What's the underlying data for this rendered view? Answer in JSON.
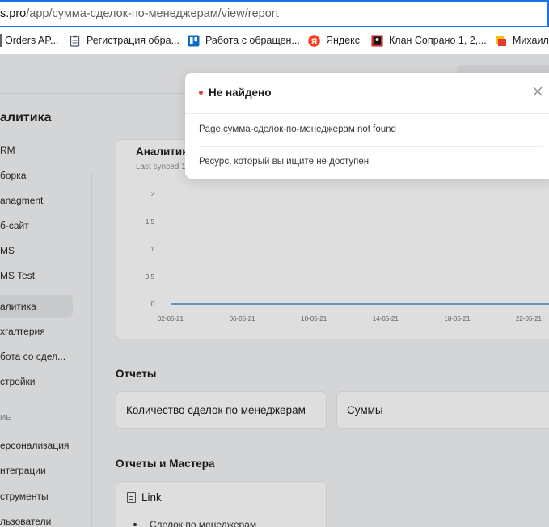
{
  "browser": {
    "url_host": "s.pro",
    "url_path": "/app/сумма-сделок-по-менеджерам/view/report",
    "bookmarks": [
      {
        "label": "Orders AP...",
        "icon": "separator-icon"
      },
      {
        "label": "Регистрация обра...",
        "icon": "clipboard-icon"
      },
      {
        "label": "Работа с обращен...",
        "icon": "trello-icon"
      },
      {
        "label": "Яндекс",
        "icon": "yandex-icon"
      },
      {
        "label": "Клан Сопрано 1, 2,...",
        "icon": "soprano-icon"
      },
      {
        "label": "Михаил",
        "icon": "folder-icon"
      }
    ]
  },
  "sidebar": {
    "title": "алитика",
    "items": [
      {
        "label": "RM"
      },
      {
        "label": "борка"
      },
      {
        "label": "anagment"
      },
      {
        "label": "б-сайт"
      },
      {
        "label": "MS"
      },
      {
        "label": "MS Test"
      },
      {
        "label": "алитика"
      },
      {
        "label": "хгалтерия"
      },
      {
        "label": "бота со сдел..."
      },
      {
        "label": "стройки"
      }
    ],
    "section_label": "ИЕ",
    "items2": [
      {
        "label": "ерсонализация"
      },
      {
        "label": "нтеграции"
      },
      {
        "label": "струменты"
      },
      {
        "label": "льзователи"
      }
    ]
  },
  "chart_card": {
    "title": "Аналитика",
    "subtitle": "Last synced 1"
  },
  "chart_data": {
    "type": "line",
    "x": [
      "02-05-21",
      "06-05-21",
      "10-05-21",
      "14-05-21",
      "18-05-21",
      "22-05-21"
    ],
    "series": [
      {
        "values": [
          0,
          0,
          0,
          0,
          0,
          0
        ]
      }
    ],
    "yticks": [
      "2",
      "1.5",
      "1",
      "0.5",
      "0"
    ],
    "ylim": [
      0,
      2
    ],
    "color": "#4a90c8"
  },
  "reports": {
    "title": "Отчеты",
    "cards": [
      {
        "label": "Количество сделок по менеджерам"
      },
      {
        "label": "Суммы"
      }
    ]
  },
  "reports_masters": {
    "title": "Отчеты и Мастера",
    "link_title": "Link",
    "link_item": "Сделок по менеджерам"
  },
  "toast": {
    "title": "Не найдено",
    "message": "Page сумма-сделок-по-менеджерам not found",
    "detail": "Ресурс, который вы ищите не доступен",
    "accent": "#e53935"
  }
}
